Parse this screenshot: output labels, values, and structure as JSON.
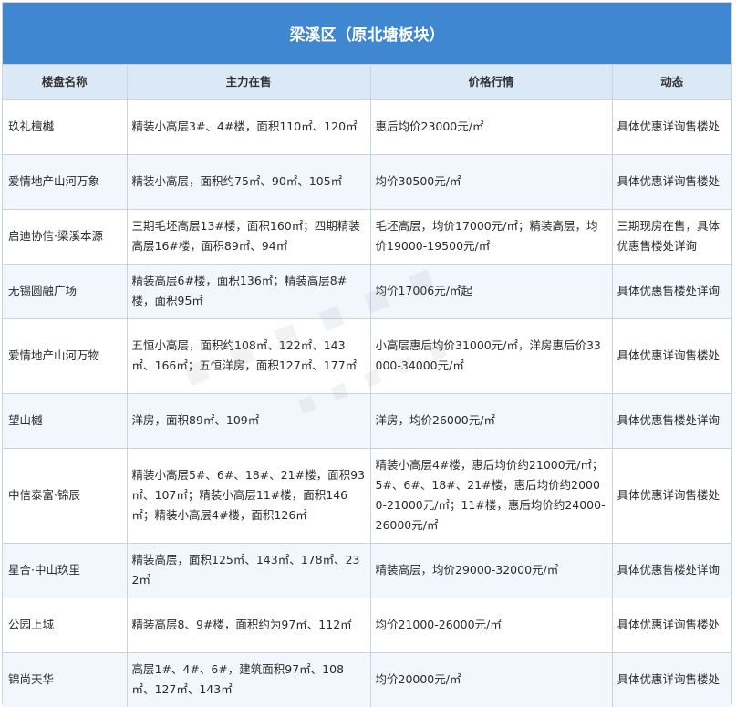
{
  "title": "梁溪区（原北塘板块）",
  "columns": [
    "楼盘名称",
    "主力在售",
    "价格行情",
    "动态"
  ],
  "rows": [
    {
      "name": "玖礼檀樾",
      "supply": "精装小高层3#、4#楼，面积110㎡、120㎡",
      "price": "惠后均价23000元/㎡",
      "status": "具体优惠详询售楼处"
    },
    {
      "name": "爱情地产山河万象",
      "supply": "精装小高层，面积约75㎡、90㎡、105㎡",
      "price": "均价30500元/㎡",
      "status": "具体优惠详询售楼处"
    },
    {
      "name": "启迪协信·梁溪本源",
      "supply": "三期毛坯高层13#楼，面积160㎡；四期精装高层16#楼，面积89㎡、94㎡",
      "price": "毛坯高层，均价17000元/㎡；精装高层，均价19000-19500元/㎡",
      "status": "三期现房在售，具体优惠售楼处详询"
    },
    {
      "name": "无锡圆融广场",
      "supply": "精装高层6#楼，面积136㎡；精装高层8#楼，面积95㎡",
      "price": "均价17006元/㎡起",
      "status": "具体优惠售楼处详询"
    },
    {
      "name": "爱情地产山河万物",
      "supply": "五恒小高层，面积约108㎡、122㎡、143㎡、166㎡；五恒洋房，面积127㎡、177㎡",
      "price": "小高层惠后均价31000元/㎡，洋房惠后价33000-34000元/㎡",
      "status": "具体优惠详询售楼处"
    },
    {
      "name": "望山樾",
      "supply": "洋房，面积89㎡、109㎡",
      "price": "洋房，均价26000元/㎡",
      "status": "具体优惠售楼处详询"
    },
    {
      "name": "中信泰富·锦辰",
      "supply": "精装小高层5#、6#、18#、21#楼，面积93㎡、107㎡；精装小高层11#楼，面积146㎡；精装小高层4#楼，面积126㎡",
      "price": "精装小高层4#楼，惠后均价约21000元/㎡；5#、6#、18#、21#楼，惠后均价约20000-21000元/㎡；11#楼，惠后均价约24000-26000元/㎡",
      "status": "具体优惠详询售楼处"
    },
    {
      "name": "星合·中山玖里",
      "supply": "精装高层，面积125㎡、143㎡、178㎡、232㎡",
      "price": "精装高层，均价29000-32000元/㎡",
      "status": "具体优惠售楼处详询"
    },
    {
      "name": "公园上城",
      "supply": "精装高层8、9#楼，面积约为97㎡、112㎡",
      "price": "均价21000-26000元/㎡",
      "status": "具体优惠详询售楼处"
    },
    {
      "name": "锦尚天华",
      "supply": "高层1#、4#、6#，建筑面积97㎡、108㎡、127㎡、143㎡",
      "price": "均价20000元/㎡",
      "status": "具体优惠详询售楼处"
    }
  ],
  "colors": {
    "title_bg": "#3f87d1",
    "header_bg": "#dbe9f7",
    "stripe_bg": "#f2f7fd",
    "border": "#c9d4df"
  }
}
